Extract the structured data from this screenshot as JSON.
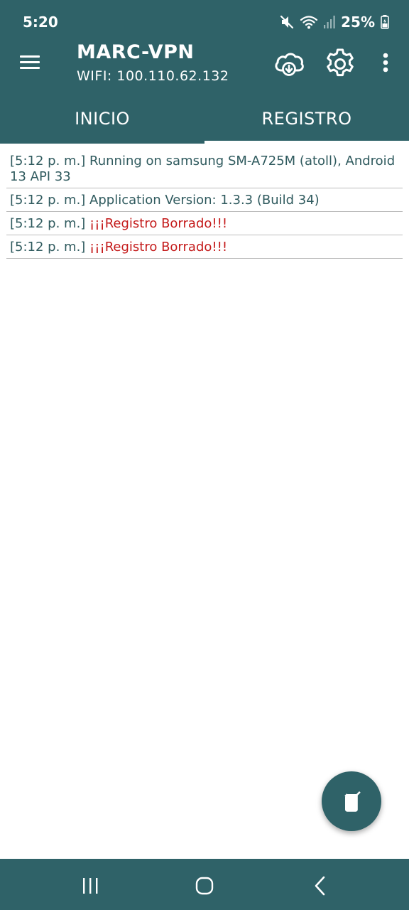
{
  "status_bar": {
    "time": "5:20",
    "battery": "25%",
    "icons": [
      "mute-icon",
      "wifi-icon",
      "signal-icon",
      "battery-icon"
    ]
  },
  "app_bar": {
    "title": "MARC-VPN",
    "subtitle": "WIFI: 100.110.62.132",
    "actions": [
      "cloud-download-icon",
      "gear-icon",
      "more-vertical-icon"
    ]
  },
  "tabs": [
    {
      "label": "INICIO",
      "selected": false
    },
    {
      "label": "REGISTRO",
      "selected": true
    }
  ],
  "log": [
    {
      "time": "[5:12 p. m.]",
      "message": "Running on samsung SM-A725M (atoll), Android 13 API 33",
      "level": "info"
    },
    {
      "time": "[5:12 p. m.]",
      "message": "Application Version: 1.3.3 (Build 34)",
      "level": "info"
    },
    {
      "time": "[5:12 p. m.]",
      "message": "¡¡¡Registro Borrado!!!",
      "level": "error"
    },
    {
      "time": "[5:12 p. m.]",
      "message": "¡¡¡Registro Borrado!!!",
      "level": "error"
    }
  ],
  "fab": {
    "icon": "clipboard-delete-icon"
  },
  "colors": {
    "primary": "#2f6268",
    "log_text": "#2f5a5e",
    "log_error": "#c41a1a",
    "divider": "#bdbdbd"
  }
}
